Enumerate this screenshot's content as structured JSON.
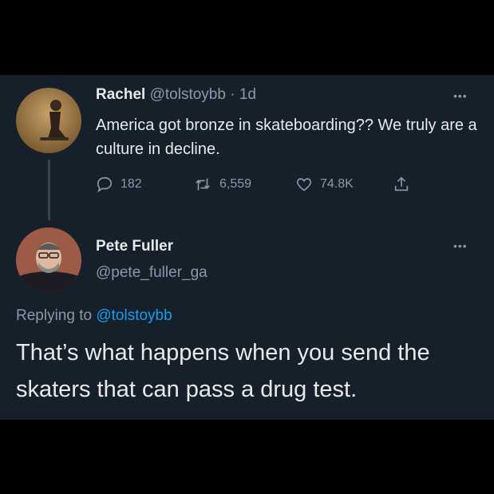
{
  "tweet": {
    "author_name": "Rachel",
    "author_handle": "@tolstoybb",
    "separator": "·",
    "age": "1d",
    "text": "America got bronze in skateboarding?? We truly are a culture in decline.",
    "more_icon": "•••",
    "actions": {
      "replies": "182",
      "retweets": "6,559",
      "likes": "74.8K"
    }
  },
  "reply": {
    "author_name": "Pete Fuller",
    "author_handle": "@pete_fuller_ga",
    "more_icon": "•••",
    "replying_prefix": "Replying to",
    "replying_handle": "@tolstoybb",
    "text": "That’s what happens when you send the skaters that can pass a drug test."
  },
  "colors": {
    "background": "#000000",
    "panel": "#15202b",
    "text": "#e7e9ea",
    "muted": "#8b98a5",
    "link": "#1d9bf0"
  },
  "icons": [
    "reply-icon",
    "retweet-icon",
    "like-icon",
    "share-icon",
    "more-icon"
  ]
}
